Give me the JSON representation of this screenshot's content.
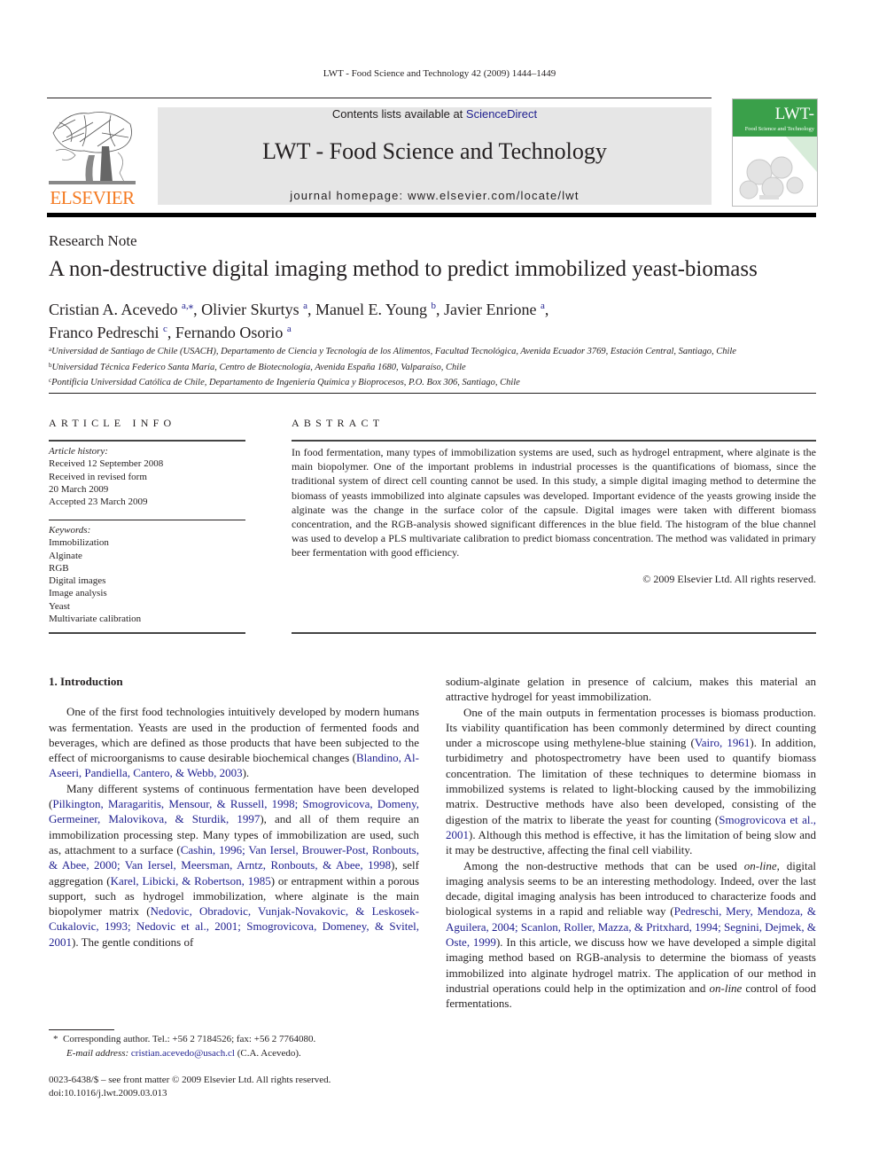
{
  "running_head": "LWT - Food Science and Technology 42 (2009) 1444–1449",
  "header": {
    "publisher_logo_text": "ELSEVIER",
    "publisher_logo_icon": "elsevier-tree-icon",
    "contents_prefix": "Contents lists available at ",
    "contents_link": "ScienceDirect",
    "journal_title": "LWT - Food Science and Technology",
    "homepage": "journal homepage: www.elsevier.com/locate/lwt",
    "cover": {
      "title": "LWT-",
      "subtitle": "Food Science and Technology"
    }
  },
  "article": {
    "type": "Research Note",
    "title": "A non-destructive digital imaging method to predict immobilized yeast-biomass",
    "authors": [
      {
        "name": "Cristian A. Acevedo",
        "sup": "a,⁎",
        "sep": ", "
      },
      {
        "name": "Olivier Skurtys",
        "sup": "a",
        "sep": ", "
      },
      {
        "name": "Manuel E. Young",
        "sup": "b",
        "sep": ", "
      },
      {
        "name": "Javier Enrione",
        "sup": "a",
        "sep": ","
      },
      {
        "name": "Franco Pedreschi",
        "sup": "c",
        "sep": ", "
      },
      {
        "name": "Fernando Osorio",
        "sup": "a",
        "sep": ""
      }
    ],
    "affiliations": [
      {
        "key": "a",
        "text": "Universidad de Santiago de Chile (USACH), Departamento de Ciencia y Tecnología de los Alimentos, Facultad Tecnológica, Avenida Ecuador 3769, Estación Central, Santiago, Chile"
      },
      {
        "key": "b",
        "text": "Universidad Técnica Federico Santa María, Centro de Biotecnología, Avenida España 1680, Valparaíso, Chile"
      },
      {
        "key": "c",
        "text": "Pontificia Universidad Católica de Chile, Departamento de Ingeniería Química y Bioprocesos, P.O. Box 306, Santiago, Chile"
      }
    ]
  },
  "article_info": {
    "heading": "ARTICLE INFO",
    "history_label": "Article history:",
    "history": [
      "Received 12 September 2008",
      "Received in revised form",
      "20 March 2009",
      "Accepted 23 March 2009"
    ],
    "keywords_label": "Keywords:",
    "keywords": [
      "Immobilization",
      "Alginate",
      "RGB",
      "Digital images",
      "Image analysis",
      "Yeast",
      "Multivariate calibration"
    ]
  },
  "abstract": {
    "heading": "ABSTRACT",
    "text": "In food fermentation, many types of immobilization systems are used, such as hydrogel entrapment, where alginate is the main biopolymer. One of the important problems in industrial processes is the quantifications of biomass, since the traditional system of direct cell counting cannot be used. In this study, a simple digital imaging method to determine the biomass of yeasts immobilized into alginate capsules was developed. Important evidence of the yeasts growing inside the alginate was the change in the surface color of the capsule. Digital images were taken with different biomass concentration, and the RGB-analysis showed significant differences in the blue field. The histogram of the blue channel was used to develop a PLS multivariate calibration to predict biomass concentration. The method was validated in primary beer fermentation with good efficiency.",
    "copyright": "© 2009 Elsevier Ltd. All rights reserved."
  },
  "body": {
    "section_heading": "1.  Introduction",
    "left_paragraphs": [
      [
        {
          "t": "One of the first food technologies intuitively developed by modern humans was fermentation. Yeasts are used in the production of fermented foods and beverages, which are defined as those products that have been subjected to the effect of microorganisms to cause desirable biochemical changes ("
        },
        {
          "t": "Blandino, Al-Aseeri, Pandiella, Cantero, & Webb, 2003",
          "link": true
        },
        {
          "t": ")."
        }
      ],
      [
        {
          "t": "Many different systems of continuous fermentation have been developed ("
        },
        {
          "t": "Pilkington, Maragaritis, Mensour, & Russell, 1998; Smogrovicova, Domeny, Germeiner, Malovikova, & Sturdik, 1997",
          "link": true
        },
        {
          "t": "), and all of them require an immobilization processing step. Many types of immobilization are used, such as, attachment to a surface ("
        },
        {
          "t": "Cashin, 1996; Van Iersel, Brouwer-Post, Ronbouts, & Abee, 2000; Van Iersel, Meersman, Arntz, Ronbouts, & Abee, 1998",
          "link": true
        },
        {
          "t": "), self aggregation ("
        },
        {
          "t": "Karel, Libicki, & Robertson, 1985",
          "link": true
        },
        {
          "t": ") or entrapment within a porous support, such as hydrogel immobilization, where alginate is the main biopolymer matrix ("
        },
        {
          "t": "Nedovic, Obradovic, Vunjak-Novakovic, & Leskosek-Cukalovic, 1993; Nedovic et al., 2001; Smogrovicova, Domeney, & Svitel, 2001",
          "link": true
        },
        {
          "t": "). The gentle conditions of"
        }
      ]
    ],
    "right_paragraphs": [
      [
        {
          "t": "sodium-alginate gelation in presence of calcium, makes this material an attractive hydrogel for yeast immobilization."
        }
      ],
      [
        {
          "t": "One of the main outputs in fermentation processes is biomass production. Its viability quantification has been commonly determined by direct counting under a microscope using methylene-blue staining ("
        },
        {
          "t": "Vairo, 1961",
          "link": true
        },
        {
          "t": "). In addition, turbidimetry and photospectrometry have been used to quantify biomass concentration. The limitation of these techniques to determine biomass in immobilized systems is related to light-blocking caused by the immobilizing matrix. Destructive methods have also been developed, consisting of the digestion of the matrix to liberate the yeast for counting ("
        },
        {
          "t": "Smogrovicova et al., 2001",
          "link": true
        },
        {
          "t": "). Although this method is effective, it has the limitation of being slow and it may be destructive, affecting the final cell viability."
        }
      ],
      [
        {
          "t": "Among the non-destructive methods that can be used "
        },
        {
          "t": "on-line",
          "italic": true
        },
        {
          "t": ", digital imaging analysis seems to be an interesting methodology. Indeed, over the last decade, digital imaging analysis has been introduced to characterize foods and biological systems in a rapid and reliable way ("
        },
        {
          "t": "Pedreschi, Mery, Mendoza, & Aguilera, 2004; Scanlon, Roller, Mazza, & Pritxhard, 1994; Segnini, Dejmek, & Oste, 1999",
          "link": true
        },
        {
          "t": "). In this article, we discuss how we have developed a simple digital imaging method based on RGB-analysis to determine the biomass of yeasts immobilized into alginate hydrogel matrix. The application of our method in industrial operations could help in the optimization and "
        },
        {
          "t": "on-line",
          "italic": true
        },
        {
          "t": " control of food fermentations."
        }
      ]
    ]
  },
  "footnote": {
    "marker": "*",
    "line1": "Corresponding author. Tel.: +56 2 7184526; fax: +56 2 7764080.",
    "email_label": "E-mail address:",
    "email": "cristian.acevedo@usach.cl",
    "email_suffix": "(C.A. Acevedo)."
  },
  "front_matter": {
    "issn_line": "0023-6438/$ – see front matter © 2009 Elsevier Ltd. All rights reserved.",
    "doi": "doi:10.1016/j.lwt.2009.03.013"
  },
  "colors": {
    "link": "#1f1f8f",
    "elsevier_orange": "#f47920",
    "banner_gray": "#e6e6e6",
    "cover_green": "#3aa04a"
  }
}
